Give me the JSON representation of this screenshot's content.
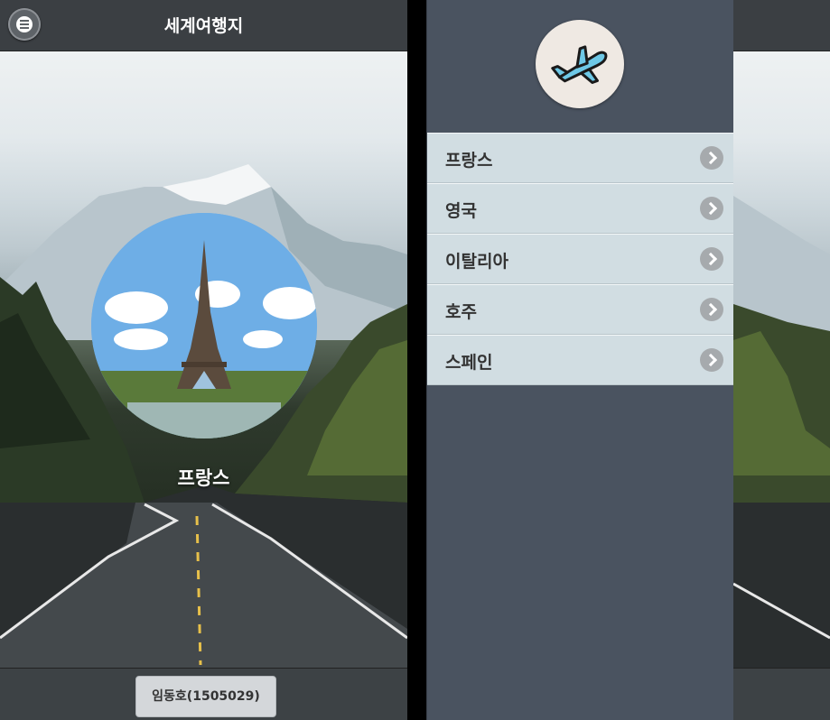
{
  "app": {
    "title": "세계여행지"
  },
  "main": {
    "destination_label": "프랑스"
  },
  "footer": {
    "author_label": "임동호(1505029)"
  },
  "panel": {
    "logo_icon": "airplane-icon",
    "items": [
      {
        "label": "프랑스"
      },
      {
        "label": "영국"
      },
      {
        "label": "이탈리아"
      },
      {
        "label": "호주"
      },
      {
        "label": "스페인"
      }
    ]
  }
}
